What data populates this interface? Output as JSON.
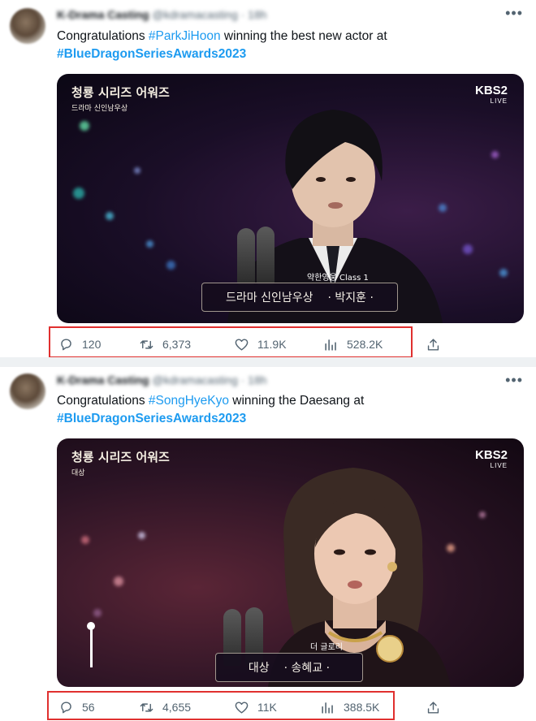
{
  "tweets": [
    {
      "text_prefix": "Congratulations ",
      "mention_tag": "#ParkJiHoon",
      "text_mid": " winning the best new actor at",
      "event_tag": "#BlueDragonSeriesAwards2023",
      "media": {
        "logo_title": "청룡 시리즈 어워즈",
        "logo_sub": "드라마 신인남우상",
        "broadcaster": "KBS2",
        "live": "LIVE",
        "caption_top": "약한영웅 Class 1",
        "caption_award": "드라마 신인남우상",
        "caption_name": "· 박지훈 ·"
      },
      "stats": {
        "replies": "120",
        "retweets": "6,373",
        "likes": "11.9K",
        "views": "528.2K"
      }
    },
    {
      "text_prefix": "Congratulations ",
      "mention_tag": "#SongHyeKyo",
      "text_mid": " winning the Daesang at",
      "event_tag": "#BlueDragonSeriesAwards2023",
      "media": {
        "logo_title": "청룡 시리즈 어워즈",
        "logo_sub": "대상",
        "broadcaster": "KBS2",
        "live": "LIVE",
        "caption_top": "더 글로리",
        "caption_award": "대상",
        "caption_name": "· 송혜교 ·"
      },
      "stats": {
        "replies": "56",
        "retweets": "4,655",
        "likes": "11K",
        "views": "388.5K"
      }
    }
  ],
  "colors": {
    "link": "#1d9bf0",
    "highlight_box": "#e0302f",
    "muted": "#536471"
  },
  "icons": [
    "reply-icon",
    "retweet-icon",
    "like-icon",
    "views-icon",
    "share-icon",
    "more-icon"
  ]
}
